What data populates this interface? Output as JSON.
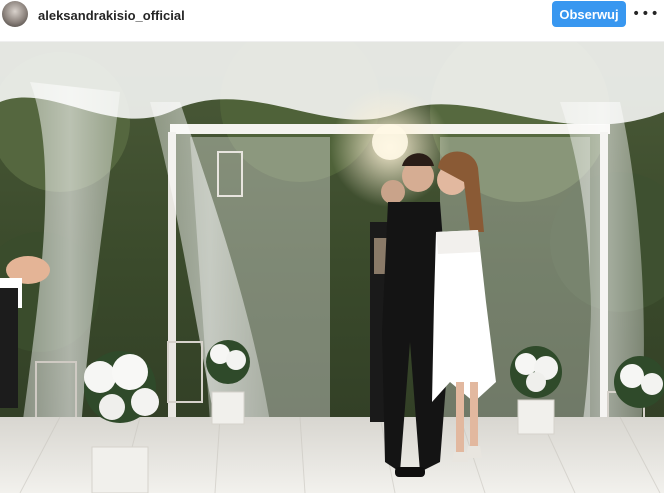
{
  "post": {
    "username": "aleksandrakisio_official",
    "follow_label": "Obserwuj",
    "more_label": "•••"
  },
  "icons": {
    "avatar": "profile-avatar",
    "more": "more-options-icon"
  },
  "colors": {
    "follow_button": "#3897f0",
    "username_text": "#262626"
  }
}
